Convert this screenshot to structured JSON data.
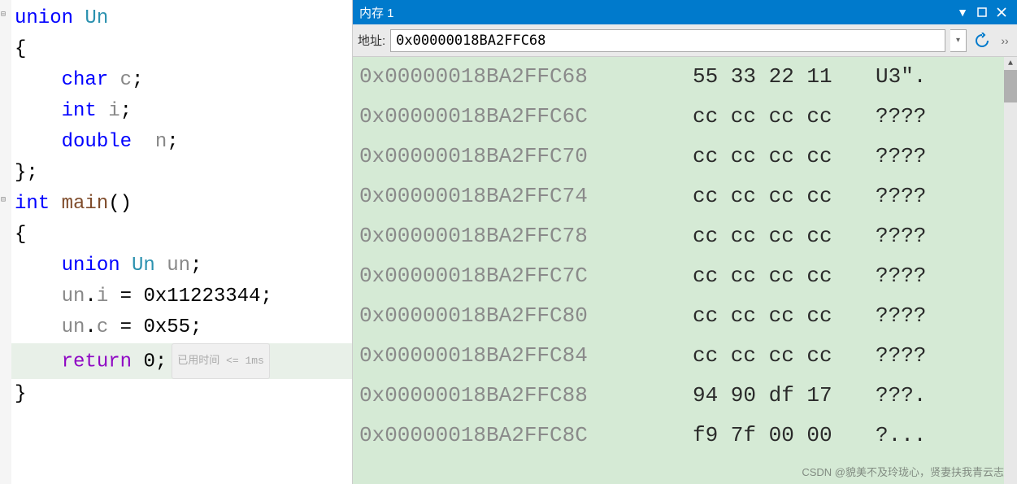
{
  "code": {
    "lines": [
      {
        "tokens": [
          {
            "t": "union ",
            "c": "kw-blue"
          },
          {
            "t": "Un",
            "c": "type-teal"
          }
        ],
        "fold": true
      },
      {
        "tokens": [
          {
            "t": "{",
            "c": ""
          }
        ]
      },
      {
        "tokens": [
          {
            "t": "    ",
            "c": ""
          },
          {
            "t": "char ",
            "c": "kw-blue"
          },
          {
            "t": "c",
            "c": "ident"
          },
          {
            "t": ";",
            "c": ""
          }
        ]
      },
      {
        "tokens": [
          {
            "t": "    ",
            "c": ""
          },
          {
            "t": "int ",
            "c": "kw-blue"
          },
          {
            "t": "i",
            "c": "ident"
          },
          {
            "t": ";",
            "c": ""
          }
        ]
      },
      {
        "tokens": [
          {
            "t": "    ",
            "c": ""
          },
          {
            "t": "double  ",
            "c": "kw-blue"
          },
          {
            "t": "n",
            "c": "ident"
          },
          {
            "t": ";",
            "c": ""
          }
        ]
      },
      {
        "tokens": [
          {
            "t": "};",
            "c": ""
          }
        ]
      },
      {
        "tokens": [
          {
            "t": "int ",
            "c": "kw-blue"
          },
          {
            "t": "main",
            "c": "func-brown"
          },
          {
            "t": "()",
            "c": ""
          }
        ],
        "fold": true
      },
      {
        "tokens": [
          {
            "t": "{",
            "c": ""
          }
        ]
      },
      {
        "tokens": [
          {
            "t": "    ",
            "c": ""
          },
          {
            "t": "union ",
            "c": "kw-blue"
          },
          {
            "t": "Un ",
            "c": "type-teal"
          },
          {
            "t": "un",
            "c": "ident"
          },
          {
            "t": ";",
            "c": ""
          }
        ]
      },
      {
        "tokens": [
          {
            "t": "    ",
            "c": ""
          },
          {
            "t": "un",
            "c": "ident"
          },
          {
            "t": ".",
            "c": ""
          },
          {
            "t": "i",
            "c": "ident"
          },
          {
            "t": " = 0x11223344;",
            "c": ""
          }
        ]
      },
      {
        "tokens": [
          {
            "t": "    ",
            "c": ""
          },
          {
            "t": "un",
            "c": "ident"
          },
          {
            "t": ".",
            "c": ""
          },
          {
            "t": "c",
            "c": "ident"
          },
          {
            "t": " = 0x55;",
            "c": ""
          }
        ]
      },
      {
        "tokens": [
          {
            "t": "    ",
            "c": ""
          },
          {
            "t": "return ",
            "c": "kw-purple"
          },
          {
            "t": "0;",
            "c": ""
          }
        ],
        "current": true,
        "hint": "已用时间 <= 1ms"
      },
      {
        "tokens": [
          {
            "t": "}",
            "c": ""
          }
        ]
      }
    ]
  },
  "memory": {
    "title": "内存 1",
    "address_label": "地址:",
    "address_value": "0x00000018BA2FFC68",
    "rows": [
      {
        "addr": "0x00000018BA2FFC68",
        "hex": "55 33 22 11",
        "ascii": "U3\"."
      },
      {
        "addr": "0x00000018BA2FFC6C",
        "hex": "cc cc cc cc",
        "ascii": "????"
      },
      {
        "addr": "0x00000018BA2FFC70",
        "hex": "cc cc cc cc",
        "ascii": "????"
      },
      {
        "addr": "0x00000018BA2FFC74",
        "hex": "cc cc cc cc",
        "ascii": "????"
      },
      {
        "addr": "0x00000018BA2FFC78",
        "hex": "cc cc cc cc",
        "ascii": "????"
      },
      {
        "addr": "0x00000018BA2FFC7C",
        "hex": "cc cc cc cc",
        "ascii": "????"
      },
      {
        "addr": "0x00000018BA2FFC80",
        "hex": "cc cc cc cc",
        "ascii": "????"
      },
      {
        "addr": "0x00000018BA2FFC84",
        "hex": "cc cc cc cc",
        "ascii": "????"
      },
      {
        "addr": "0x00000018BA2FFC88",
        "hex": "94 90 df 17",
        "ascii": "???."
      },
      {
        "addr": "0x00000018BA2FFC8C",
        "hex": "f9 7f 00 00",
        "ascii": "?..."
      }
    ]
  },
  "watermark": "CSDN @貌美不及玲珑心，贤妻扶我青云志"
}
